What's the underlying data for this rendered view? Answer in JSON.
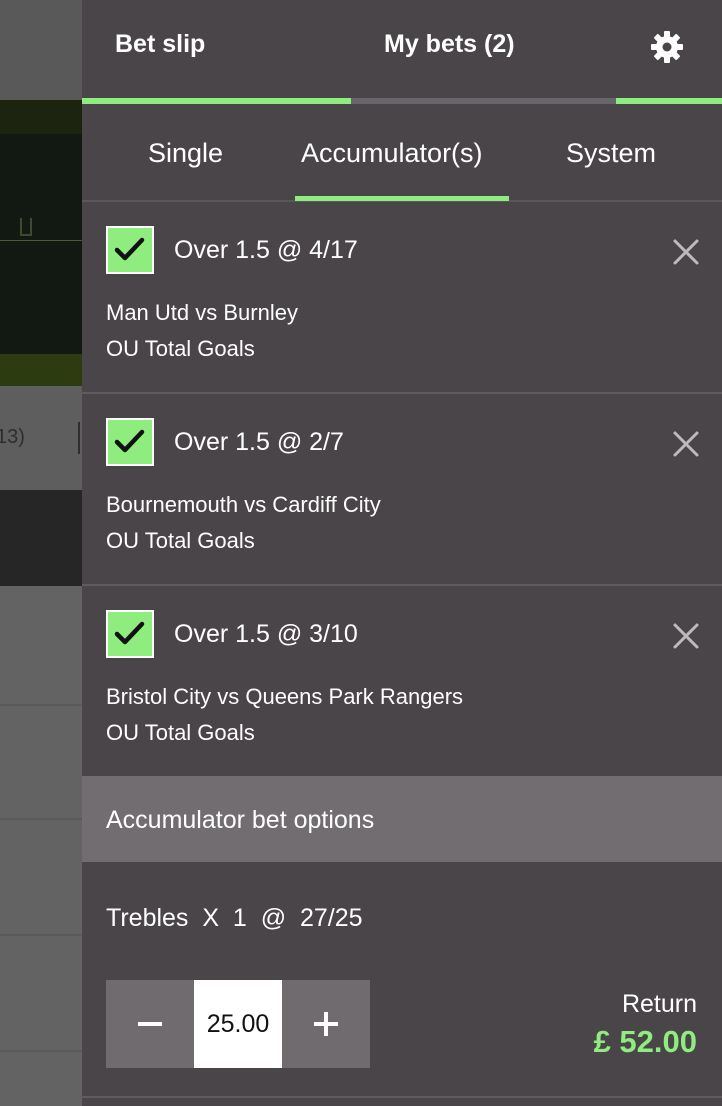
{
  "background": {
    "score_fragment": "13)"
  },
  "header": {
    "tabs": [
      {
        "label": "Bet slip",
        "active": true
      },
      {
        "label": "My bets (2)",
        "active": false
      }
    ],
    "settings_icon": "gear-icon"
  },
  "bet_type_tabs": [
    {
      "label": "Single",
      "active": false
    },
    {
      "label": "Accumulator(s)",
      "active": true
    },
    {
      "label": "System",
      "active": false
    }
  ],
  "selections": [
    {
      "checked": true,
      "title": "Over 1.5 @ 4/17",
      "match": "Man Utd vs Burnley",
      "market": "OU Total Goals"
    },
    {
      "checked": true,
      "title": "Over 1.5 @ 2/7",
      "match": "Bournemouth vs Cardiff City",
      "market": "OU Total Goals"
    },
    {
      "checked": true,
      "title": "Over 1.5 @ 3/10",
      "match": "Bristol City vs Queens Park Rangers",
      "market": "OU Total Goals"
    }
  ],
  "options": {
    "header": "Accumulator bet options",
    "bet_line": "Trebles  X  1  @  27/25",
    "stake": "25.00",
    "return_label": "Return",
    "return_value": "£ 52.00"
  },
  "colors": {
    "accent": "#8fec7f",
    "panel_bg": "#4a4548",
    "options_header_bg": "#716d70"
  }
}
